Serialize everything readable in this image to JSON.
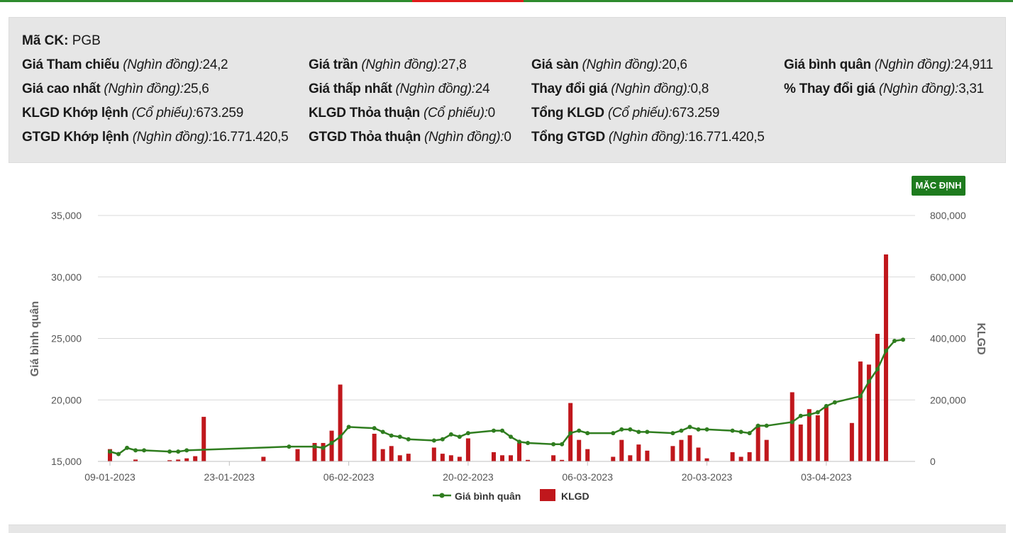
{
  "info": {
    "ma_ck": {
      "label": "Mã CK:",
      "value": "PGB"
    },
    "rows": [
      [
        {
          "label": "Giá Tham chiếu",
          "unit": "(Nghìn đồng):",
          "value": "24,2"
        },
        {
          "label": "Giá trần",
          "unit": "(Nghìn đồng):",
          "value": "27,8"
        },
        {
          "label": "Giá sàn",
          "unit": "(Nghìn đồng):",
          "value": "20,6"
        },
        {
          "label": "Giá bình quân",
          "unit": "(Nghìn đồng):",
          "value": "24,911"
        }
      ],
      [
        {
          "label": "Giá cao nhất",
          "unit": "(Nghìn đồng):",
          "value": "25,6"
        },
        {
          "label": "Giá thấp nhất",
          "unit": "(Nghìn đồng):",
          "value": "24"
        },
        {
          "label": "Thay đổi giá",
          "unit": "(Nghìn đồng):",
          "value": "0,8"
        },
        {
          "label": "% Thay đổi giá",
          "unit": "(Nghìn đồng):",
          "value": "3,31"
        }
      ],
      [
        {
          "label": "KLGD Khớp lệnh",
          "unit": "(Cổ phiếu):",
          "value": "673.259"
        },
        {
          "label": "KLGD Thỏa thuận",
          "unit": "(Cổ phiếu):",
          "value": "0"
        },
        {
          "label": "Tổng KLGD",
          "unit": "(Cổ phiếu):",
          "value": "673.259"
        }
      ],
      [
        {
          "label": "GTGD Khớp lệnh",
          "unit": "(Nghìn đồng):",
          "value": "16.771.420,5"
        },
        {
          "label": "GTGD Thỏa thuận",
          "unit": "(Nghìn đồng):",
          "value": "0"
        },
        {
          "label": "Tổng GTGD",
          "unit": "(Nghìn đồng):",
          "value": "16.771.420,5"
        }
      ]
    ]
  },
  "button": {
    "label": "MẶC ĐỊNH"
  },
  "colors": {
    "line": "#2f7d1f",
    "bar": "#c0171c",
    "button": "#1e7b1e"
  },
  "chart_data": {
    "type": "bar",
    "x_ticks": [
      "09-01-2023",
      "23-01-2023",
      "06-02-2023",
      "20-02-2023",
      "06-03-2023",
      "20-03-2023",
      "03-04-2023"
    ],
    "y_left": {
      "label": "Giá bình quân",
      "ticks": [
        "15,000",
        "20,000",
        "25,000",
        "30,000",
        "35,000"
      ],
      "range": [
        15000,
        35000
      ]
    },
    "y_right": {
      "label": "KLGD",
      "ticks": [
        "0",
        "200,000",
        "400,000",
        "600,000",
        "800,000"
      ],
      "range": [
        0,
        800000
      ]
    },
    "legend": {
      "position": "bottom",
      "items": [
        "Giá bình quân",
        "KLGD"
      ]
    },
    "grid": true,
    "series": [
      {
        "name": "Giá bình quân",
        "type": "line",
        "points": [
          [
            "2023-01-09",
            15800
          ],
          [
            "2023-01-10",
            15600
          ],
          [
            "2023-01-11",
            16100
          ],
          [
            "2023-01-12",
            15900
          ],
          [
            "2023-01-13",
            15900
          ],
          [
            "2023-01-16",
            15800
          ],
          [
            "2023-01-17",
            15800
          ],
          [
            "2023-01-18",
            15900
          ],
          [
            "2023-01-30",
            16200
          ],
          [
            "2023-02-02",
            16200
          ],
          [
            "2023-02-03",
            16100
          ],
          [
            "2023-02-04",
            16500
          ],
          [
            "2023-02-05",
            17000
          ],
          [
            "2023-02-06",
            17800
          ],
          [
            "2023-02-09",
            17700
          ],
          [
            "2023-02-10",
            17400
          ],
          [
            "2023-02-11",
            17100
          ],
          [
            "2023-02-12",
            17000
          ],
          [
            "2023-02-13",
            16800
          ],
          [
            "2023-02-16",
            16700
          ],
          [
            "2023-02-17",
            16800
          ],
          [
            "2023-02-18",
            17200
          ],
          [
            "2023-02-19",
            17000
          ],
          [
            "2023-02-20",
            17300
          ],
          [
            "2023-02-23",
            17500
          ],
          [
            "2023-02-24",
            17500
          ],
          [
            "2023-02-25",
            17000
          ],
          [
            "2023-02-26",
            16600
          ],
          [
            "2023-02-27",
            16500
          ],
          [
            "2023-03-02",
            16400
          ],
          [
            "2023-03-03",
            16400
          ],
          [
            "2023-03-04",
            17300
          ],
          [
            "2023-03-05",
            17500
          ],
          [
            "2023-03-06",
            17300
          ],
          [
            "2023-03-09",
            17300
          ],
          [
            "2023-03-10",
            17600
          ],
          [
            "2023-03-11",
            17600
          ],
          [
            "2023-03-12",
            17400
          ],
          [
            "2023-03-13",
            17400
          ],
          [
            "2023-03-16",
            17300
          ],
          [
            "2023-03-17",
            17500
          ],
          [
            "2023-03-18",
            17800
          ],
          [
            "2023-03-19",
            17600
          ],
          [
            "2023-03-20",
            17600
          ],
          [
            "2023-03-23",
            17500
          ],
          [
            "2023-03-24",
            17400
          ],
          [
            "2023-03-25",
            17300
          ],
          [
            "2023-03-26",
            17900
          ],
          [
            "2023-03-27",
            17900
          ],
          [
            "2023-03-30",
            18200
          ],
          [
            "2023-03-31",
            18700
          ],
          [
            "2023-04-01",
            18800
          ],
          [
            "2023-04-02",
            19000
          ],
          [
            "2023-04-03",
            19500
          ],
          [
            "2023-04-04",
            19800
          ],
          [
            "2023-04-07",
            20300
          ],
          [
            "2023-04-08",
            21500
          ],
          [
            "2023-04-09",
            22500
          ],
          [
            "2023-04-10",
            24000
          ],
          [
            "2023-04-11",
            24800
          ],
          [
            "2023-04-12",
            24900
          ]
        ]
      },
      {
        "name": "KLGD",
        "type": "bar",
        "points": [
          [
            "2023-01-09",
            40000
          ],
          [
            "2023-01-12",
            6000
          ],
          [
            "2023-01-16",
            4000
          ],
          [
            "2023-01-17",
            6000
          ],
          [
            "2023-01-18",
            10000
          ],
          [
            "2023-01-19",
            17000
          ],
          [
            "2023-01-20",
            145000
          ],
          [
            "2023-01-27",
            15000
          ],
          [
            "2023-01-31",
            40000
          ],
          [
            "2023-02-02",
            60000
          ],
          [
            "2023-02-03",
            60000
          ],
          [
            "2023-02-04",
            100000
          ],
          [
            "2023-02-05",
            250000
          ],
          [
            "2023-02-09",
            90000
          ],
          [
            "2023-02-10",
            40000
          ],
          [
            "2023-02-11",
            50000
          ],
          [
            "2023-02-12",
            20000
          ],
          [
            "2023-02-13",
            25000
          ],
          [
            "2023-02-16",
            45000
          ],
          [
            "2023-02-17",
            25000
          ],
          [
            "2023-02-18",
            20000
          ],
          [
            "2023-02-19",
            15000
          ],
          [
            "2023-02-20",
            75000
          ],
          [
            "2023-02-23",
            30000
          ],
          [
            "2023-02-24",
            20000
          ],
          [
            "2023-02-25",
            20000
          ],
          [
            "2023-02-26",
            60000
          ],
          [
            "2023-02-27",
            5000
          ],
          [
            "2023-03-02",
            20000
          ],
          [
            "2023-03-03",
            5000
          ],
          [
            "2023-03-04",
            190000
          ],
          [
            "2023-03-05",
            70000
          ],
          [
            "2023-03-06",
            40000
          ],
          [
            "2023-03-09",
            15000
          ],
          [
            "2023-03-10",
            70000
          ],
          [
            "2023-03-11",
            20000
          ],
          [
            "2023-03-12",
            55000
          ],
          [
            "2023-03-13",
            35000
          ],
          [
            "2023-03-16",
            50000
          ],
          [
            "2023-03-17",
            70000
          ],
          [
            "2023-03-18",
            85000
          ],
          [
            "2023-03-19",
            45000
          ],
          [
            "2023-03-20",
            10000
          ],
          [
            "2023-03-23",
            30000
          ],
          [
            "2023-03-24",
            15000
          ],
          [
            "2023-03-25",
            30000
          ],
          [
            "2023-03-26",
            120000
          ],
          [
            "2023-03-27",
            70000
          ],
          [
            "2023-03-30",
            225000
          ],
          [
            "2023-03-31",
            120000
          ],
          [
            "2023-04-01",
            170000
          ],
          [
            "2023-04-02",
            150000
          ],
          [
            "2023-04-03",
            180000
          ],
          [
            "2023-04-06",
            125000
          ],
          [
            "2023-04-07",
            325000
          ],
          [
            "2023-04-08",
            315000
          ],
          [
            "2023-04-09",
            415000
          ],
          [
            "2023-04-10",
            673259
          ]
        ]
      }
    ]
  }
}
